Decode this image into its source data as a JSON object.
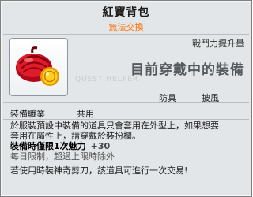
{
  "tooltip": {
    "title": "紅寶背包",
    "subtitle": "無法交換",
    "stat_label": "戰鬥力提升量",
    "main_label": "目前穿戴中的裝備",
    "watermark": "QUEST HELPER",
    "parts": [
      "防具",
      "披風"
    ],
    "job_title": "裝備職業",
    "job_value": "共用",
    "desc_line1": "於服裝預設中裝備的道具只會套用在外型上，如果想要",
    "desc_line2": "套用在屬性上，請穿戴於裝扮欄。",
    "stat_line": "裝備時僅限1次魅力",
    "stat_bonus": "+30",
    "limit_line1": "每日限制，超過上限時除外",
    "limit_line2": "若使用時裝神奇剪刀，該道具可進行一次交易!"
  },
  "colors": {
    "subtitle": "#ff6f00",
    "background": "#e2e6e9",
    "bag_red": "#d41020",
    "coin_gold": "#f5b800"
  },
  "icons": [
    "red-bag-icon",
    "gold-coin-icon"
  ]
}
